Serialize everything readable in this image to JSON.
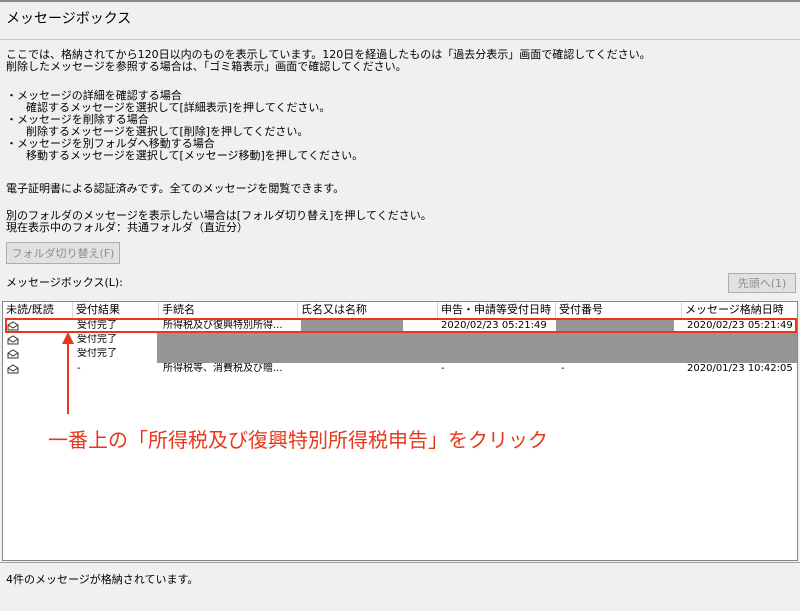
{
  "window": {
    "title": "メッセージボックス"
  },
  "intro": {
    "line1": "ここでは、格納されてから120日以内のものを表示しています。120日を経過したものは「過去分表示」画面で確認してください。",
    "line2": "削除したメッセージを参照する場合は、「ゴミ箱表示」画面で確認してください。"
  },
  "instructions": [
    {
      "title": "・メッセージの詳細を確認する場合",
      "detail": "確認するメッセージを選択して[詳細表示]を押してください。"
    },
    {
      "title": "・メッセージを削除する場合",
      "detail": "削除するメッセージを選択して[削除]を押してください。"
    },
    {
      "title": "・メッセージを別フォルダへ移動する場合",
      "detail": "移動するメッセージを選択して[メッセージ移動]を押してください。"
    }
  ],
  "cert_note": "電子証明書による認証済みです。全てのメッセージを閲覧できます。",
  "folder": {
    "note": "別のフォルダのメッセージを表示したい場合は[フォルダ切り替え]を押してください。",
    "current": "現在表示中のフォルダ：共通フォルダ（直近分）",
    "switch_button": "フォルダ切り替え(F)"
  },
  "list": {
    "label": "メッセージボックス(L):",
    "top_button": "先頭へ(1)",
    "columns": [
      "未読/既読",
      "受付結果",
      "手続名",
      "氏名又は名称",
      "申告・申請等受付日時",
      "受付番号",
      "メッセージ格納日時"
    ],
    "rows": [
      {
        "result": "受付完了",
        "procedure": "所得税及び復興特別所得...",
        "date": "2020/02/23 05:21:49",
        "stored": "2020/02/23 05:21:49"
      },
      {
        "result": "受付完了",
        "procedure": "",
        "date": "",
        "stored": ""
      },
      {
        "result": "受付完了",
        "procedure": "",
        "date": "",
        "stored": ""
      },
      {
        "result": "-",
        "procedure": "所得税等、消費税及び贈...",
        "date": "-",
        "number": "-",
        "stored": "2020/01/23 10:42:05"
      }
    ]
  },
  "annotation": {
    "text": "一番上の「所得税及び復興特別所得税申告」をクリック",
    "color": "#e8381b"
  },
  "status": {
    "text": "4件のメッセージが格納されています。"
  }
}
